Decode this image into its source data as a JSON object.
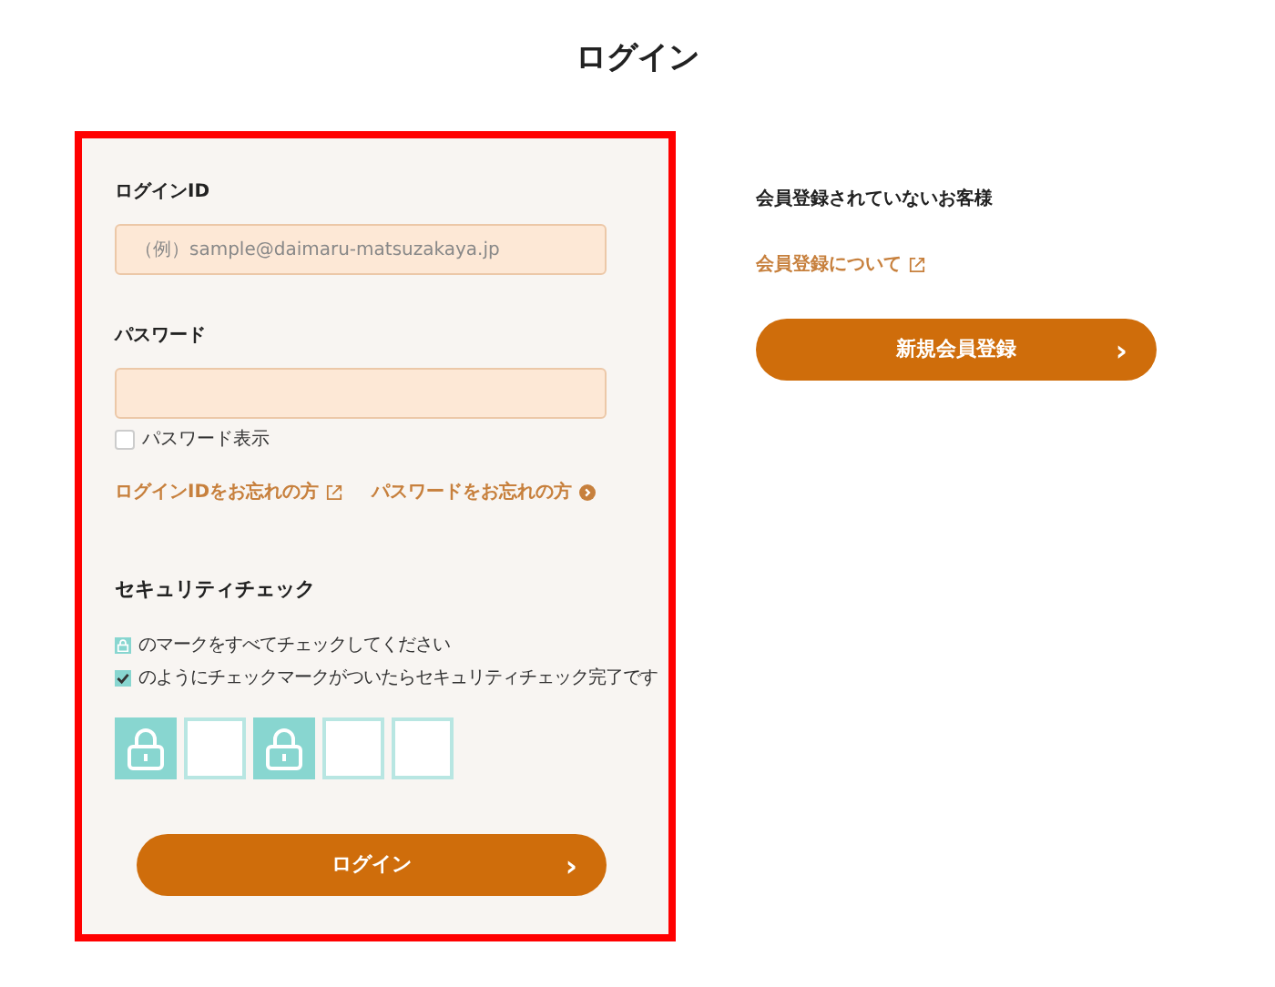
{
  "title": "ログイン",
  "login_form": {
    "fields": [
      {
        "label": "ログインID",
        "placeholder": "（例）sample@daimaru-matsuzakaya.jp"
      },
      {
        "label": "パスワード"
      }
    ],
    "show_password": {
      "label": "パスワード表示",
      "checked": false
    },
    "links": [
      {
        "text": "ログインIDをお忘れの方",
        "kind": "external"
      },
      {
        "text": "パスワードをお忘れの方",
        "kind": "arrow"
      }
    ],
    "security_check": {
      "heading": "セキュリティチェック",
      "notes": [
        {
          "kind": "lock",
          "text": "のマークをすべてチェックしてください"
        },
        {
          "kind": "check",
          "text": "のようにチェックマークがついたらセキュリティチェック完了です"
        }
      ],
      "tiles": [
        {
          "selected": true
        },
        {
          "selected": false
        },
        {
          "selected": true
        },
        {
          "selected": false
        },
        {
          "selected": false
        }
      ]
    },
    "button": {
      "label": "ログイン",
      "icon": "›"
    }
  },
  "register": {
    "heading": "会員登録されていないお客様",
    "link": "会員登録について",
    "button": {
      "label": "新規会員登録",
      "icon": "›"
    }
  }
}
